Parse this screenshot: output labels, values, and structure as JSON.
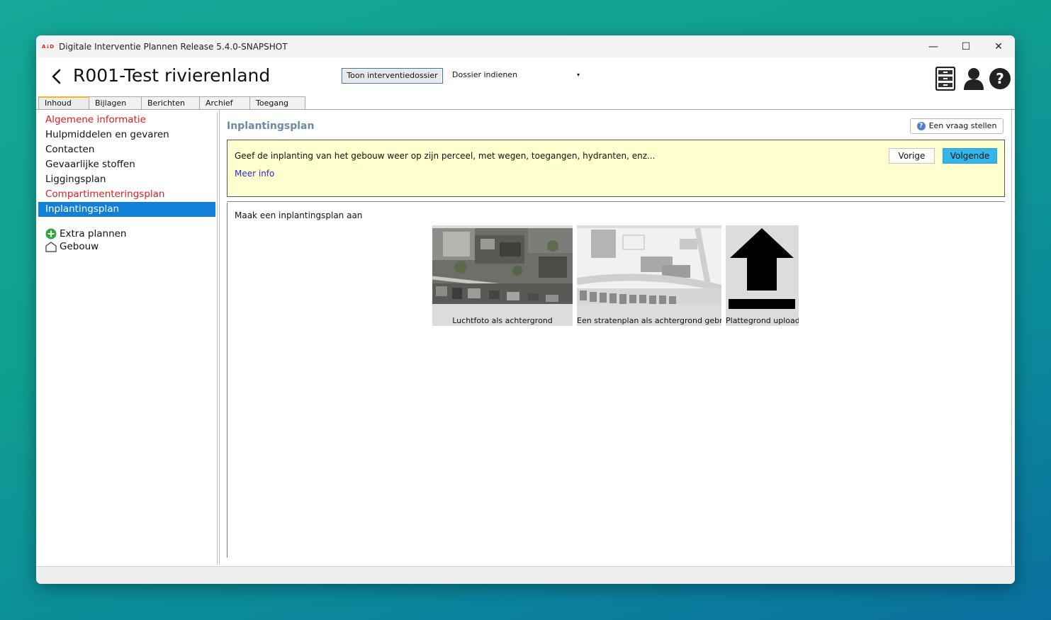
{
  "window": {
    "title": "Digitale Interventie Plannen Release 5.4.0-SNAPSHOT",
    "app_icon_text": "A↓D",
    "controls": {
      "minimize": "—",
      "maximize": "☐",
      "close": "✕"
    }
  },
  "header": {
    "dossier_title": "R001-Test rivierenland",
    "toon_button": "Toon interventiedossier",
    "dossier_select": {
      "value": "Dossier indienen",
      "chevron": "▾"
    },
    "icons": [
      "cabinet-icon",
      "user-icon",
      "help-icon"
    ]
  },
  "tabs": [
    {
      "label": "Inhoud",
      "active": true
    },
    {
      "label": "Bijlagen"
    },
    {
      "label": "Berichten"
    },
    {
      "label": "Archief"
    },
    {
      "label": "Toegang"
    }
  ],
  "sidebar": {
    "items": [
      {
        "label": "Algemene informatie",
        "status": "incomplete"
      },
      {
        "label": "Hulpmiddelen en gevaren"
      },
      {
        "label": "Contacten"
      },
      {
        "label": "Gevaarlijke stoffen"
      },
      {
        "label": "Liggingsplan"
      },
      {
        "label": "Compartimenteringsplan",
        "status": "incomplete"
      },
      {
        "label": "Inplantingsplan",
        "selected": true
      }
    ],
    "extra": [
      {
        "label": "Extra plannen",
        "icon": "add-circle-icon"
      },
      {
        "label": "Gebouw",
        "icon": "building-icon"
      }
    ]
  },
  "main": {
    "section_title": "Inplantingsplan",
    "vraag_button": "Een vraag stellen",
    "vraag_icon_glyph": "?",
    "info": {
      "text": "Geef de inplanting van het gebouw weer op zijn perceel, met wegen, toegangen, hydranten, enz...",
      "meer_info": "Meer info",
      "vorige": "Vorige",
      "volgende": "Volgende"
    },
    "create_label": "Maak een inplantingsplan aan",
    "tiles": [
      {
        "label": "Luchtfoto als achtergrond",
        "icon": "aerial-photo-thumbnail"
      },
      {
        "label": "Een stratenplan als achtergrond gebruiken",
        "icon": "street-map-thumbnail"
      },
      {
        "label": "Plattegrond uploaden",
        "icon": "upload-icon"
      }
    ]
  },
  "colors": {
    "incomplete": "#e11b1b",
    "selected": "#1280d8",
    "accent_button": "#35b6ea",
    "info_background": "#ffffcf",
    "section_title": "#6c8aa8",
    "link": "#2a2ad0"
  }
}
